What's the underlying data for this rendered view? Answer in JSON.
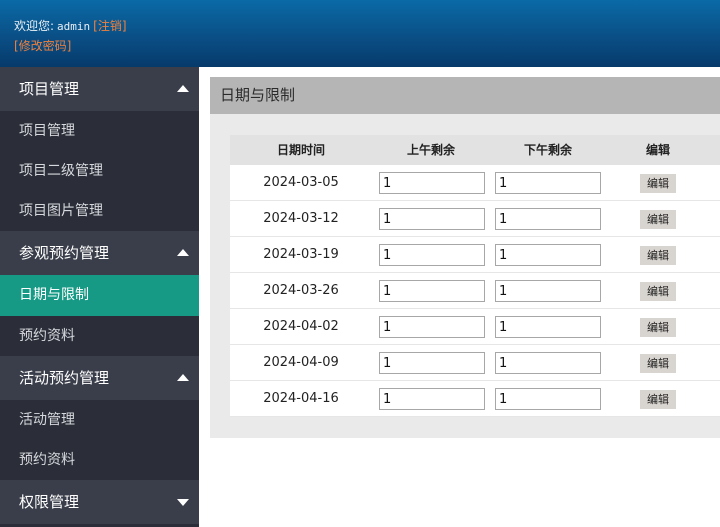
{
  "header": {
    "welcome_text": "欢迎您:",
    "username": "admin",
    "logout_label": "[注销]",
    "change_password_label": "[修改密码]"
  },
  "sidebar": {
    "groups": [
      {
        "label": "项目管理",
        "expanded": true,
        "items": [
          {
            "label": "项目管理"
          },
          {
            "label": "项目二级管理"
          },
          {
            "label": "项目图片管理"
          }
        ]
      },
      {
        "label": "参观预约管理",
        "expanded": true,
        "items": [
          {
            "label": "日期与限制",
            "active": true
          },
          {
            "label": "预约资料"
          }
        ]
      },
      {
        "label": "活动预约管理",
        "expanded": true,
        "items": [
          {
            "label": "活动管理"
          },
          {
            "label": "预约资料"
          }
        ]
      },
      {
        "label": "权限管理",
        "expanded": false,
        "items": []
      }
    ]
  },
  "main": {
    "title": "日期与限制",
    "table": {
      "headers": [
        "日期时间",
        "上午剩余",
        "下午剩余",
        "编辑"
      ],
      "rows": [
        {
          "date": "2024-03-05",
          "am": "1",
          "pm": "1",
          "edit": "编辑"
        },
        {
          "date": "2024-03-12",
          "am": "1",
          "pm": "1",
          "edit": "编辑"
        },
        {
          "date": "2024-03-19",
          "am": "1",
          "pm": "1",
          "edit": "编辑"
        },
        {
          "date": "2024-03-26",
          "am": "1",
          "pm": "1",
          "edit": "编辑"
        },
        {
          "date": "2024-04-02",
          "am": "1",
          "pm": "1",
          "edit": "编辑"
        },
        {
          "date": "2024-04-09",
          "am": "1",
          "pm": "1",
          "edit": "编辑"
        },
        {
          "date": "2024-04-16",
          "am": "1",
          "pm": "1",
          "edit": "编辑"
        }
      ]
    }
  },
  "colors": {
    "header_top": "#0a6aa6",
    "header_bottom": "#063a6b",
    "accent_orange": "#f0803c",
    "sidebar_bg": "#2b2e38",
    "sidebar_group_bg": "#3a3e4a",
    "active_item": "#169a85"
  }
}
